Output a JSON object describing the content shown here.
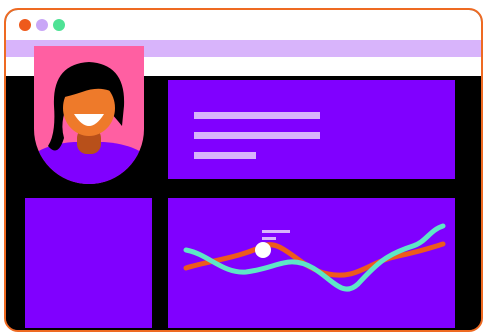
{
  "window": {
    "controls": [
      "close-dot",
      "minimize-dot",
      "maximize-dot"
    ],
    "frame_color": "#ee6a22",
    "accent_purple": "#8000ff",
    "light_lavender": "#d8b4fb"
  },
  "profile": {
    "avatar_bg": "#ff5fa2",
    "skin_color": "#ee7a2a",
    "hair_color": "#000000",
    "shirt_color": "#8000ff"
  },
  "header_card": {
    "placeholder_lines": 3
  },
  "chart": {
    "series_colors": [
      "#ee5a1c",
      "#5ee6c6"
    ],
    "marker_color": "#ffffff"
  }
}
